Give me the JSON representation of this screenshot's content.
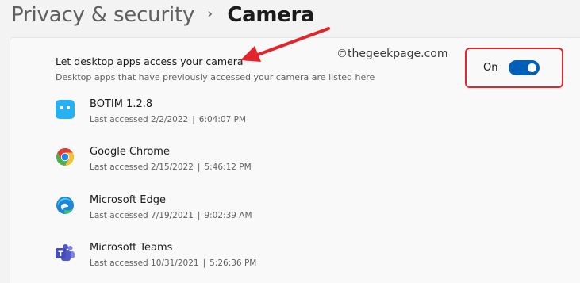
{
  "breadcrumb": {
    "parent": "Privacy & security",
    "separator": "›",
    "current": "Camera"
  },
  "setting": {
    "title": "Let desktop apps access your camera",
    "description": "Desktop apps that have previously accessed your camera are listed here",
    "toggle_label": "On",
    "toggle_state": "on"
  },
  "watermark": "©thegeekpage.com",
  "apps": [
    {
      "name": "BOTIM 1.2.8",
      "last_label": "Last accessed 2/2/2022",
      "time": "6:04:07 PM",
      "icon": "botim-icon"
    },
    {
      "name": "Google Chrome",
      "last_label": "Last accessed 2/15/2022",
      "time": "5:46:12 PM",
      "icon": "chrome-icon"
    },
    {
      "name": "Microsoft Edge",
      "last_label": "Last accessed 7/19/2021",
      "time": "9:02:39 AM",
      "icon": "edge-icon"
    },
    {
      "name": "Microsoft Teams",
      "last_label": "Last accessed 10/31/2021",
      "time": "5:26:36 PM",
      "icon": "teams-icon"
    }
  ],
  "separator_char": "|",
  "colors": {
    "accent": "#005fb8",
    "annotation": "#e3242b",
    "background": "#f3f3f3",
    "panel": "#f9f9f9"
  }
}
